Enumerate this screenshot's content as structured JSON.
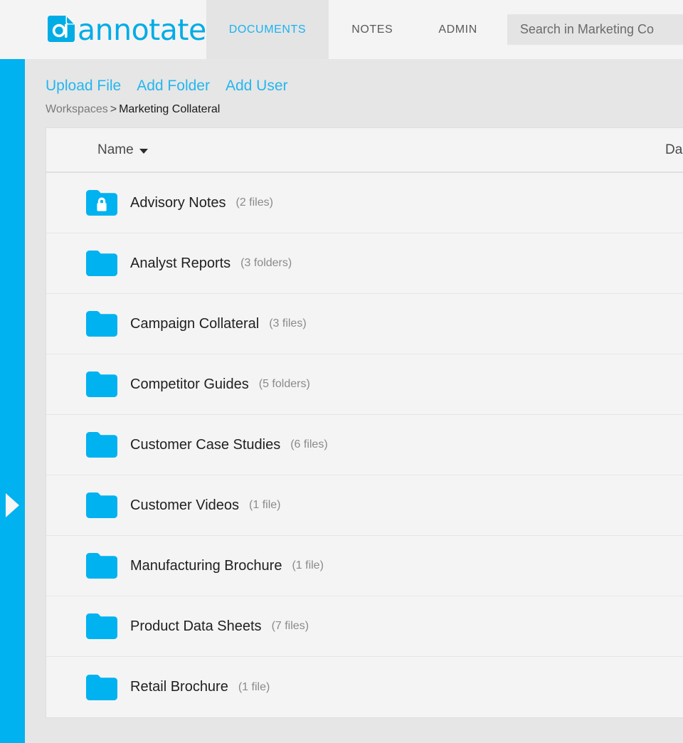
{
  "brand": {
    "name": "annotate",
    "color": "#00ace6",
    "rail_color": "#00b2f0"
  },
  "header": {
    "tabs": [
      {
        "label": "DOCUMENTS",
        "active": true
      },
      {
        "label": "NOTES",
        "active": false
      },
      {
        "label": "ADMIN",
        "active": false
      }
    ],
    "search": {
      "placeholder": "Search in Marketing Co",
      "value": ""
    }
  },
  "toolbar": {
    "actions": [
      {
        "label": "Upload File"
      },
      {
        "label": "Add Folder"
      },
      {
        "label": "Add User"
      }
    ]
  },
  "breadcrumb": {
    "root": "Workspaces",
    "separator": ">",
    "current": "Marketing Collateral"
  },
  "table": {
    "columns": {
      "name": "Name",
      "date": "Da"
    },
    "sort": {
      "column": "Name",
      "direction": "desc",
      "icon": "chevron-down-icon"
    },
    "rows": [
      {
        "name": "Advisory Notes",
        "count": "(2 files)",
        "icon": "locked-folder-icon"
      },
      {
        "name": "Analyst Reports",
        "count": "(3 folders)",
        "icon": "folder-icon"
      },
      {
        "name": "Campaign Collateral",
        "count": "(3 files)",
        "icon": "folder-icon"
      },
      {
        "name": "Competitor Guides",
        "count": "(5 folders)",
        "icon": "folder-icon"
      },
      {
        "name": "Customer Case Studies",
        "count": "(6 files)",
        "icon": "folder-icon"
      },
      {
        "name": "Customer Videos",
        "count": "(1 file)",
        "icon": "folder-icon"
      },
      {
        "name": "Manufacturing Brochure",
        "count": "(1 file)",
        "icon": "folder-icon"
      },
      {
        "name": "Product Data Sheets",
        "count": "(7 files)",
        "icon": "folder-icon"
      },
      {
        "name": "Retail Brochure",
        "count": "(1 file)",
        "icon": "folder-icon"
      }
    ]
  },
  "sidebar": {
    "expand_icon": "triangle-right-icon"
  }
}
